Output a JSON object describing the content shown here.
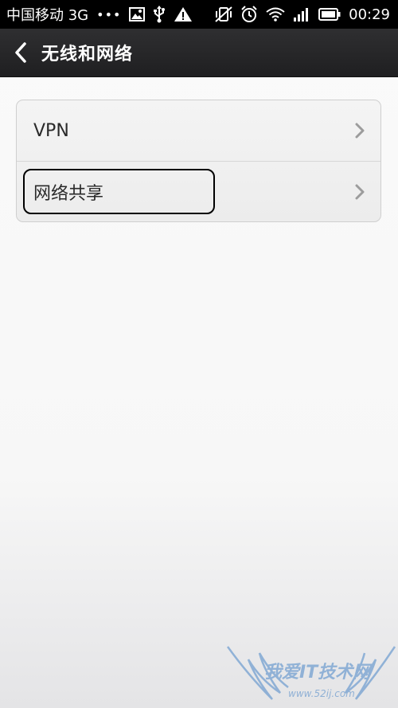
{
  "status_bar": {
    "carrier": "中国移动 3G",
    "dots": "•••",
    "time": "00:29"
  },
  "header": {
    "title": "无线和网络"
  },
  "settings": {
    "items": [
      {
        "label": "VPN"
      },
      {
        "label": "网络共享"
      }
    ]
  },
  "watermark": {
    "text": "我爱IT技术网",
    "url": "www.52ij.com"
  },
  "colors": {
    "status_bar_bg": "#000000",
    "title_bar_bg": "#2a2a2c",
    "text_primary": "#2a2a2a",
    "watermark": "#4a86c8"
  }
}
